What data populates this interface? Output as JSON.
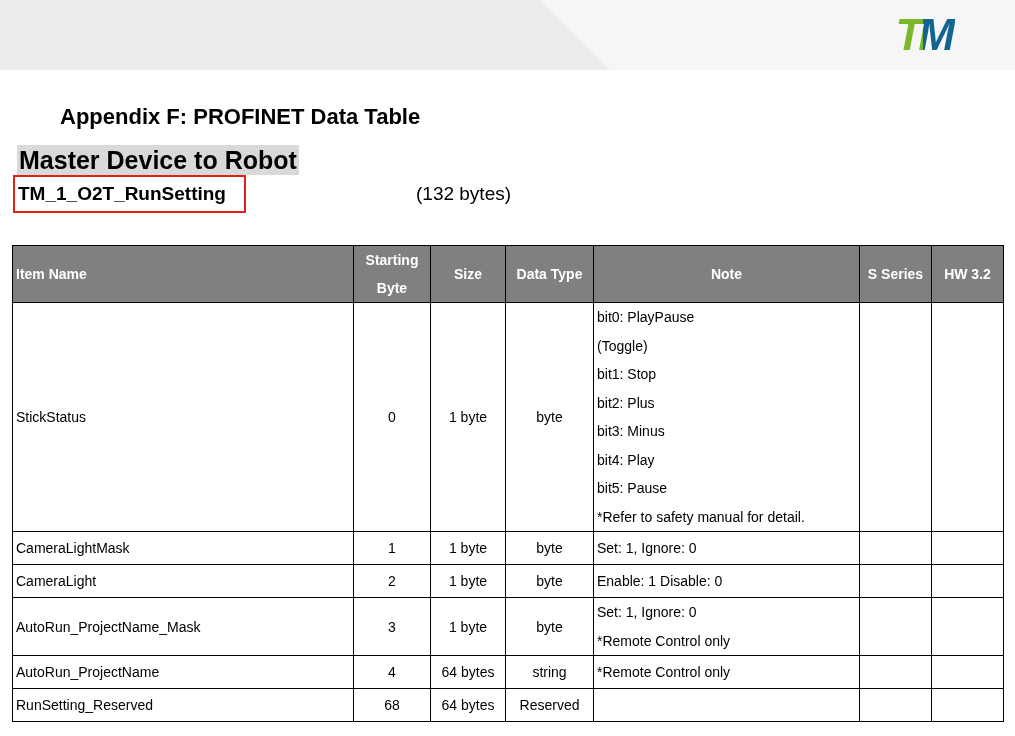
{
  "header": {
    "logo": "TM"
  },
  "title": "Appendix F: PROFINET Data Table",
  "section": "Master Device to Robot",
  "table_name": {
    "label": "TM_1_O2T_RunSetting",
    "highlighted": true
  },
  "table_size": "(132 bytes)",
  "columns": [
    "Item Name",
    "Starting Byte",
    "Size",
    "Data Type",
    "Note",
    "S Series",
    "HW 3.2"
  ],
  "rows": [
    {
      "item": "StickStatus",
      "start": "0",
      "size": "1 byte",
      "type": "byte",
      "note": [
        "bit0: PlayPause",
        "(Toggle)",
        "bit1: Stop",
        "bit2: Plus",
        "bit3: Minus",
        "bit4: Play",
        "bit5: Pause",
        "*Refer to safety manual for detail."
      ]
    },
    {
      "item": "CameraLightMask",
      "start": "1",
      "size": "1 byte",
      "type": "byte",
      "note": [
        "Set: 1, Ignore: 0"
      ]
    },
    {
      "item": "CameraLight",
      "start": "2",
      "size": "1 byte",
      "type": "byte",
      "note": [
        "Enable: 1 Disable: 0"
      ]
    },
    {
      "item": "AutoRun_ProjectName_Mask",
      "start": "3",
      "size": "1 byte",
      "type": "byte",
      "note": [
        "Set: 1, Ignore: 0",
        "*Remote Control only"
      ]
    },
    {
      "item": "AutoRun_ProjectName",
      "start": "4",
      "size": "64 bytes",
      "type": "string",
      "note": [
        "*Remote Control only"
      ]
    },
    {
      "item": "RunSetting_Reserved",
      "start": "68",
      "size": "64 bytes",
      "type": "Reserved",
      "note": []
    }
  ]
}
